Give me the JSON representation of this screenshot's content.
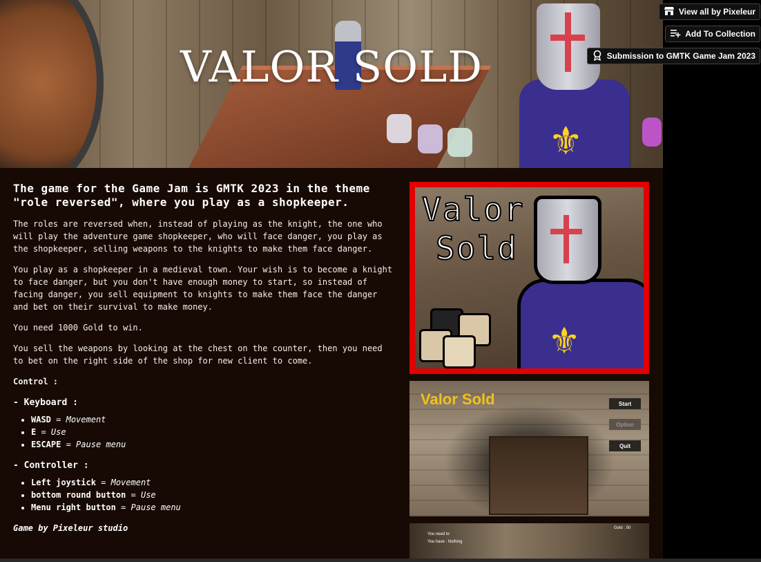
{
  "game": {
    "title": "VALOR SOLD"
  },
  "toolbar": {
    "view_all": "View all by Pixeleur",
    "add_collection": "Add To Collection",
    "submission": "Submission to GMTK Game Jam 2023"
  },
  "description": {
    "headline": "The game for the Game Jam is GMTK 2023 in the theme \"role reversed\", where you play as a shopkeeper.",
    "paragraphs": [
      "The roles are reversed when, instead of playing as the knight, the one who will play the adventure game shopkeeper, who will face danger, you play as the shopkeeper, selling weapons to the knights to make them face danger.",
      "You play as a shopkeeper in a medieval town. Your wish is to become a knight to face danger, but you don't have enough money to start, so instead of facing danger, you sell equipment to knights to make them face the danger and bet on their survival to make money.",
      "You need 1000 Gold to win.",
      "You sell the weapons by looking at the chest on the counter, then you need to bet on the right side of the shop for new client to come."
    ],
    "control_label": "Control  :",
    "keyboard_heading": "- Keyboard :",
    "keyboard": [
      {
        "key": "WASD",
        "sep": " = ",
        "action": "Movement"
      },
      {
        "key": "E",
        "sep": " = ",
        "action": "Use"
      },
      {
        "key": "ESCAPE",
        "sep": " = ",
        "action": "Pause menu"
      }
    ],
    "controller_heading": "- Controller :",
    "controller": [
      {
        "key": "Left joystick",
        "sep": " = ",
        "action": "Movement"
      },
      {
        "key": "bottom round button",
        "sep": " = ",
        "action": "Use"
      },
      {
        "key": "Menu right button",
        "sep": " = ",
        "action": "Pause menu"
      }
    ],
    "credit": "Game by Pixeleur studio"
  },
  "screenshots": {
    "cover": {
      "line1": "Valor",
      "line2": "Sold"
    },
    "menu": {
      "title": "Valor Sold",
      "buttons": [
        "Start",
        "Option",
        "Quit"
      ]
    },
    "ingame": {
      "gold": "Gold : 50",
      "need": "You need to",
      "have": "You have : Nothing"
    }
  },
  "colors": {
    "page_bg": "#170a04",
    "cover_border": "#e20000",
    "menu_title": "#f0c21a",
    "knight_tabard": "#3a2f8f",
    "fleur": "#ffd21f"
  }
}
